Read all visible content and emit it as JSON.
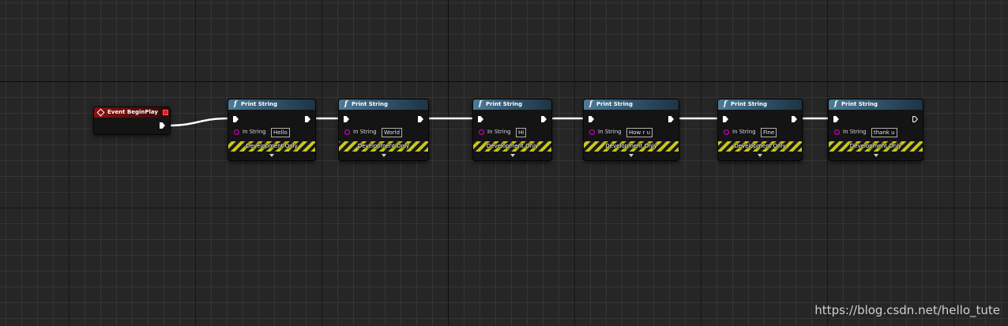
{
  "event_node": {
    "title": "Event BeginPlay"
  },
  "print_nodes": [
    {
      "title": "Print String",
      "in_string_label": "In String",
      "value": "Hello",
      "dev_label": "Development Only"
    },
    {
      "title": "Print String",
      "in_string_label": "In String",
      "value": "World",
      "dev_label": "Development Only"
    },
    {
      "title": "Print String",
      "in_string_label": "In String",
      "value": "Hi",
      "dev_label": "Development Only"
    },
    {
      "title": "Print String",
      "in_string_label": "In String",
      "value": "How r u",
      "dev_label": "Development Only"
    },
    {
      "title": "Print String",
      "in_string_label": "In String",
      "value": "Fine",
      "dev_label": "Development Only"
    },
    {
      "title": "Print String",
      "in_string_label": "In String",
      "value": "thank u",
      "dev_label": "Development Only"
    }
  ],
  "icons": {
    "event": "diamond-event-icon",
    "function": "function-f-icon",
    "exec": "exec-pin-icon",
    "string": "string-pin-icon",
    "delegate": "delegate-pin-icon",
    "expand": "chevron-down-icon"
  },
  "colors": {
    "background": "#262626",
    "event_header": "#8a1010",
    "function_header": "#4d7c98",
    "string_pin": "#e000c8",
    "dev_stripe": "#c8c81e",
    "wire": "#ffffff"
  },
  "watermark": "https://blog.csdn.net/hello_tute"
}
